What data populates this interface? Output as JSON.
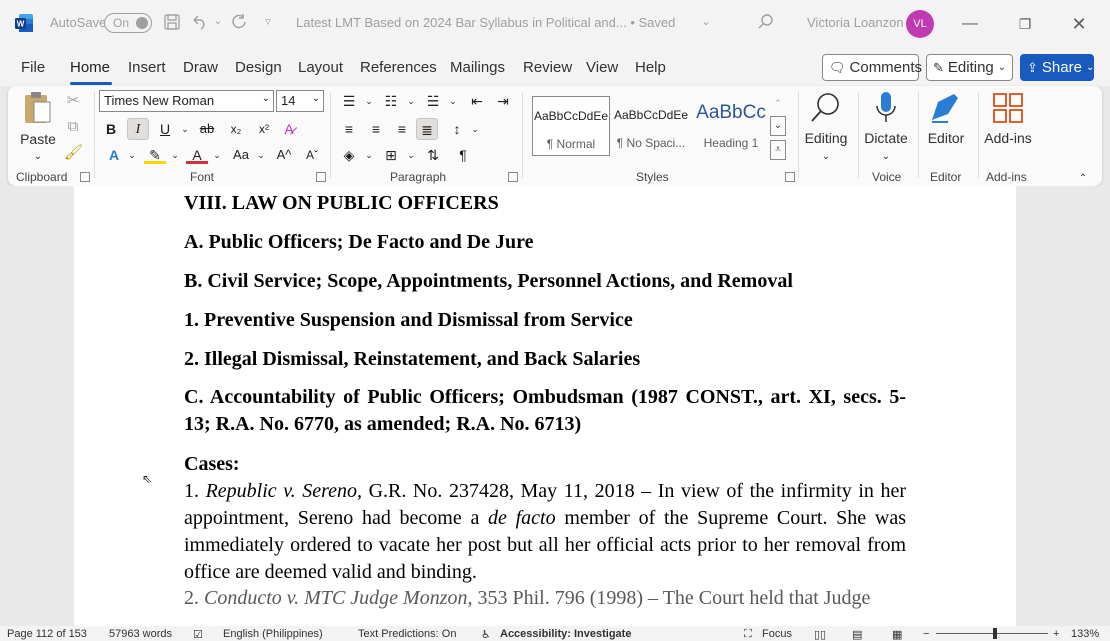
{
  "titlebar": {
    "autosave_label": "AutoSave",
    "autosave_state": "On",
    "doc_title": "Latest LMT Based on  2024 Bar Syllabus in Political and... • Saved",
    "user_name": "Victoria Loanzon",
    "avatar_initials": "VL",
    "avatar_color": "#c239b3"
  },
  "menu": {
    "tabs": [
      "File",
      "Home",
      "Insert",
      "Draw",
      "Design",
      "Layout",
      "References",
      "Mailings",
      "Review",
      "View",
      "Help"
    ],
    "comments_label": "Comments",
    "editing_label": "Editing",
    "share_label": "Share"
  },
  "ribbon": {
    "clipboard": {
      "paste_label": "Paste",
      "group_label": "Clipboard"
    },
    "font": {
      "font_name": "Times New Roman",
      "font_size": "14",
      "group_label": "Font"
    },
    "paragraph": {
      "group_label": "Paragraph"
    },
    "styles": {
      "group_label": "Styles",
      "items": [
        {
          "preview": "AaBbCcDdEe",
          "name": "¶ Normal"
        },
        {
          "preview": "AaBbCcDdEe",
          "name": "¶ No Spaci..."
        },
        {
          "preview": "AaBbCc",
          "name": "Heading 1"
        }
      ]
    },
    "editing_btn": "Editing",
    "dictate_btn": "Dictate",
    "voice_group": "Voice",
    "editor_btn": "Editor",
    "editor_group": "Editor",
    "addins_btn": "Add-ins",
    "addins_group": "Add-ins"
  },
  "document": {
    "h_viii": "VIII. LAW ON PUBLIC OFFICERS",
    "h_a": "A. Public Officers; De Facto and De Jure",
    "h_b": "B. Civil Service; Scope, Appointments, Personnel Actions, and Removal",
    "h_1": "1. Preventive Suspension and Dismissal from Service",
    "h_2": "2. Illegal Dismissal, Reinstatement, and Back Salaries",
    "h_c": "C. Accountability of Public Officers; Ombudsman (1987 CONST., art. XI, secs. 5- 13; R.A. No. 6770, as amended; R.A. No. 6713)",
    "cases": "Cases:",
    "case1_num": "1. ",
    "case1_title": "Republic v. Sereno,",
    "case1_a": " G.R. No. 237428, May 11, 2018 – In view of the infirmity in her appointment, Sereno had become a ",
    "case1_italic": "de facto",
    "case1_b": " member of the Supreme Court. She was immediately ordered to vacate her post but all her official acts prior to her removal from office are deemed valid and binding.",
    "case2_num": "2. ",
    "case2_title": "Conducto v. MTC Judge Monzon,",
    "case2_a": " 353 Phil. 796 (1998) – The Court held that Judge"
  },
  "statusbar": {
    "page": "Page 112 of 153",
    "words": "57963 words",
    "language": "English (Philippines)",
    "text_predictions": "Text Predictions: On",
    "accessibility": "Accessibility: Investigate",
    "focus": "Focus",
    "zoom": "133%"
  }
}
